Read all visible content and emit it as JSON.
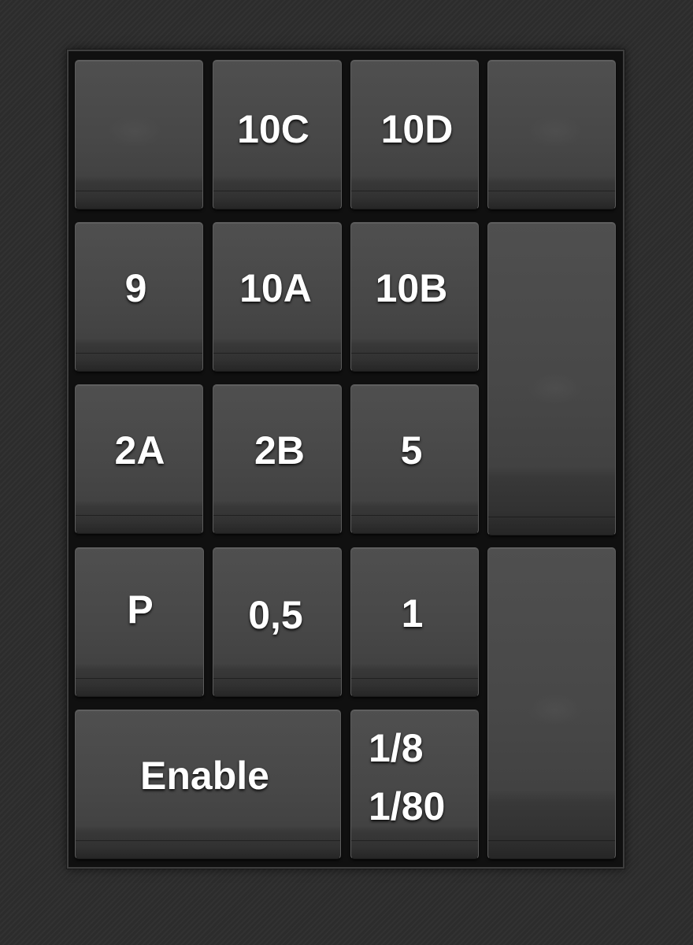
{
  "keypad": {
    "keys": [
      {
        "id": "blank-1",
        "label": ""
      },
      {
        "id": "10c",
        "label": "10C"
      },
      {
        "id": "10d",
        "label": "10D"
      },
      {
        "id": "blank-2",
        "label": ""
      },
      {
        "id": "9",
        "label": "9"
      },
      {
        "id": "10a",
        "label": "10A"
      },
      {
        "id": "10b",
        "label": "10B"
      },
      {
        "id": "blank-tall-1",
        "label": ""
      },
      {
        "id": "2a",
        "label": "2A"
      },
      {
        "id": "2b",
        "label": "2B"
      },
      {
        "id": "5",
        "label": "5"
      },
      {
        "id": "p",
        "label": "P"
      },
      {
        "id": "0-5",
        "label": "0,5"
      },
      {
        "id": "1",
        "label": "1"
      },
      {
        "id": "blank-tall-2",
        "label": ""
      },
      {
        "id": "enable",
        "label": "Enable"
      },
      {
        "id": "fraction",
        "label": "1/8\n1/80"
      }
    ]
  },
  "colors": {
    "background": "#2d2d2d",
    "panel": "#101010",
    "key": "#474747",
    "text": "#ffffff"
  }
}
